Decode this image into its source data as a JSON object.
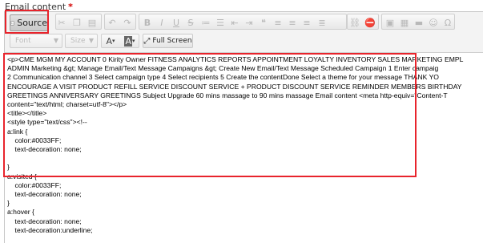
{
  "field": {
    "label": "Email content",
    "required_mark": "*"
  },
  "toolbar": {
    "source_label": "Source",
    "font_placeholder": "Font",
    "size_placeholder": "Size",
    "fullscreen_label": "Full Screen",
    "text_color_label": "A",
    "bg_color_label": "A"
  },
  "editor": {
    "lines": [
      "<p>CME MGM MY ACCOUNT 0 Kirity Owner FITNESS ANALYTICS REPORTS APPOINTMENT LOYALTY INVENTORY SALES MARKETING EMPL",
      "ADMIN Marketing &gt; Manage Email/Text Message Campaigns &gt; Create New Email/Text Message Scheduled Campaign 1 Enter campaig",
      "2 Communication channel 3 Select campaign type 4 Select recipients 5 Create the contentDone Select a theme for your message THANK YO",
      "ENCOURAGE A VISIT PRODUCT REFILL SERVICE DISCOUNT SERVICE + PRODUCT DISCOUNT SERVICE REMINDER MEMBERS BIRTHDAY",
      "GREETINGS ANNIVERSARY GREETINGS Subject Upgrade 60 mins massage to 90 mins massage Email content <meta http-equiv=\"Content-T",
      "content=\"text/html; charset=utf-8\"></p>",
      "<title></title>",
      "<style type=\"text/css\"><!--",
      "a:link {",
      "    color:#0033FF;",
      "    text-decoration: none;",
      "",
      "}",
      "a:visited {",
      "    color:#0033FF;",
      "    text-decoration: none;",
      "}",
      "a:hover {",
      "    text-decoration: none;",
      "    text-decoration:underline;"
    ]
  }
}
